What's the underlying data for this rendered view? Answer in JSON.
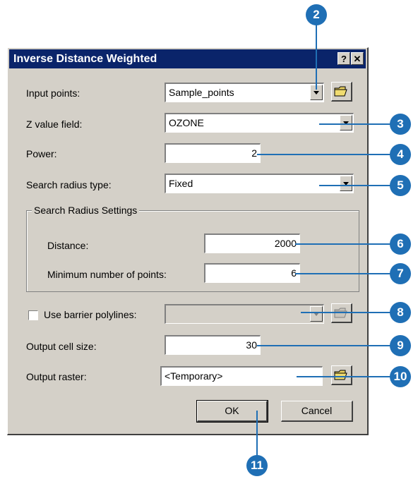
{
  "dialog": {
    "title": "Inverse Distance Weighted",
    "help_label": "?",
    "close_label": "✕",
    "input_points": {
      "label": "Input points:",
      "value": "Sample_points"
    },
    "z_value_field": {
      "label": "Z value field:",
      "value": "OZONE"
    },
    "power": {
      "label": "Power:",
      "value": "2"
    },
    "search_radius_type": {
      "label": "Search radius type:",
      "value": "Fixed"
    },
    "search_radius_settings": {
      "title": "Search Radius Settings",
      "distance": {
        "label": "Distance:",
        "value": "2000"
      },
      "min_points": {
        "label": "Minimum number of points:",
        "value": "6"
      }
    },
    "barrier": {
      "label": "Use barrier polylines:",
      "checked": false,
      "value": ""
    },
    "cell_size": {
      "label": "Output cell size:",
      "value": "30"
    },
    "output_raster": {
      "label": "Output raster:",
      "value": "<Temporary>"
    },
    "ok_label": "OK",
    "cancel_label": "Cancel"
  },
  "callouts": [
    "2",
    "3",
    "4",
    "5",
    "6",
    "7",
    "8",
    "9",
    "10",
    "11"
  ],
  "colors": {
    "callout": "#1f6fb5",
    "titlebar": "#0a246a",
    "dialog_bg": "#d4d0c8"
  },
  "icons": {
    "browse": "open-folder-icon",
    "dropdown": "chevron-down-icon"
  }
}
